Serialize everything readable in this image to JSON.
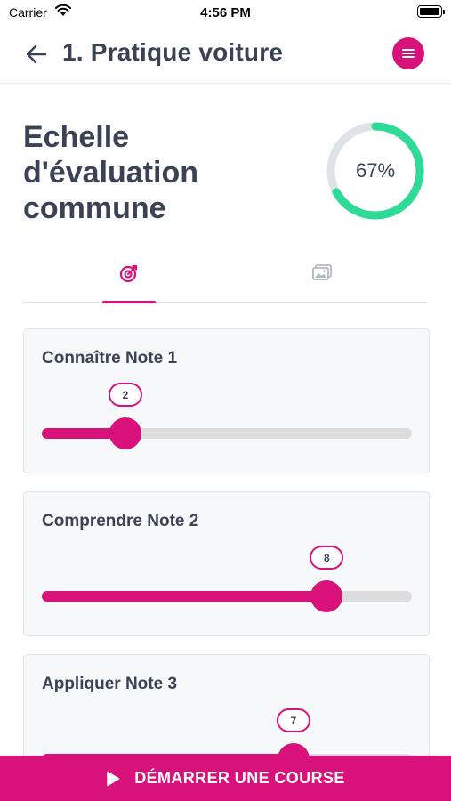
{
  "status_bar": {
    "carrier": "Carrier",
    "time": "4:56 PM"
  },
  "header": {
    "title": "1. Pratique voiture"
  },
  "main": {
    "heading": "Echelle d'évaluation commune",
    "progress": {
      "percent": 67,
      "label": "67%"
    }
  },
  "tabs": [
    {
      "icon": "target-icon",
      "active": true
    },
    {
      "icon": "images-icon",
      "active": false
    }
  ],
  "sliders": [
    {
      "title": "Connaître Note 1",
      "value": 2,
      "value_label": "2",
      "fraction": 0.226
    },
    {
      "title": "Comprendre Note 2",
      "value": 8,
      "value_label": "8",
      "fraction": 0.77
    },
    {
      "title": "Appliquer Note 3",
      "value": 7,
      "value_label": "7",
      "fraction": 0.68
    }
  ],
  "cta": {
    "label": "DÉMARRER UNE COURSE",
    "icon": "play-icon"
  },
  "colors": {
    "accent": "#d9117a",
    "progress": "#2edb96",
    "track": "#dcdcdc",
    "text": "#3b4256"
  }
}
